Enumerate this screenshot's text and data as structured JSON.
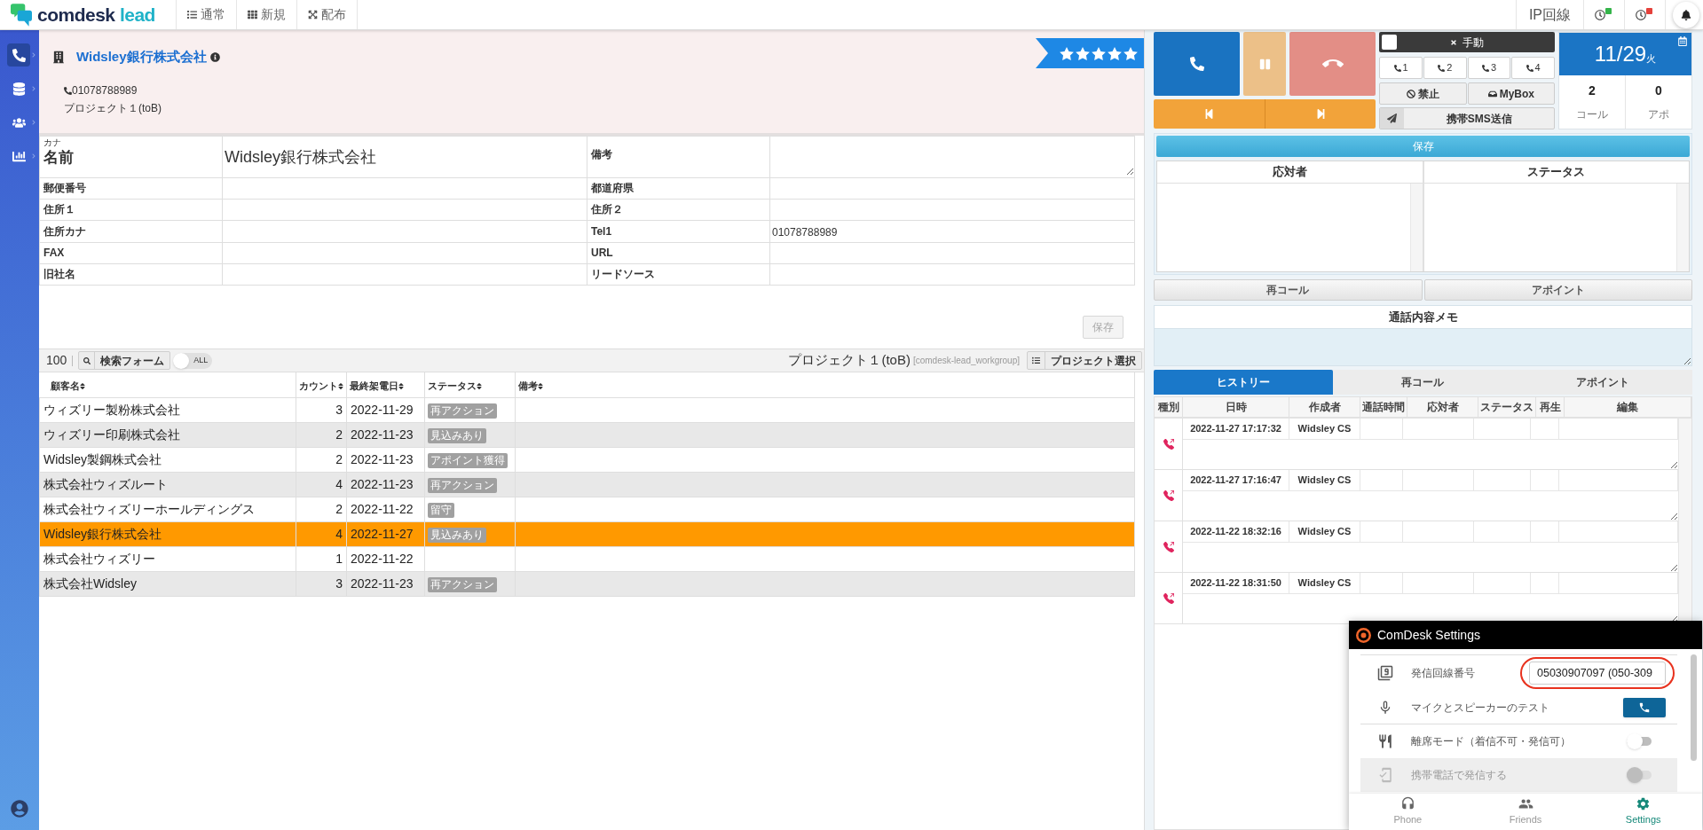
{
  "top_bar": {
    "logo": {
      "primary": "comdesk",
      "secondary": "lead"
    },
    "nav": [
      {
        "label": "通常"
      },
      {
        "label": "新規"
      },
      {
        "label": "配布"
      }
    ],
    "line_type": "IP回線",
    "indicators": [
      {
        "color": "#35b44a"
      },
      {
        "color": "#e5413b"
      }
    ]
  },
  "sidebar": {
    "items": [
      {
        "kind": "phone",
        "selected": true
      },
      {
        "kind": "database",
        "selected": false
      },
      {
        "kind": "users",
        "selected": false
      },
      {
        "kind": "chart",
        "selected": false
      }
    ]
  },
  "header": {
    "company": "Widsley銀行株式会社",
    "phone": "01078788989",
    "project": "プロジェクト１(toB)",
    "stars": 5
  },
  "form": {
    "rows": [
      {
        "cells": [
          {
            "kind": "text",
            "kana": "カナ",
            "label": "名前",
            "value": "Widsley銀行株式会社"
          },
          {
            "kind": "textarea",
            "label": "備考"
          }
        ]
      },
      {
        "cells": [
          {
            "kind": "text",
            "label": "郵便番号"
          },
          {
            "kind": "text",
            "label": "都道府県"
          }
        ]
      },
      {
        "cells": [
          {
            "kind": "text",
            "label": "住所１"
          },
          {
            "kind": "text",
            "label": "住所２"
          }
        ]
      },
      {
        "cells": [
          {
            "kind": "text",
            "label": "住所カナ"
          },
          {
            "kind": "text",
            "label": "Tel1",
            "value": "01078788989"
          }
        ]
      },
      {
        "cells": [
          {
            "kind": "text",
            "label": "FAX"
          },
          {
            "kind": "text",
            "label": "URL"
          }
        ]
      },
      {
        "cells": [
          {
            "kind": "text",
            "label": "旧社名"
          },
          {
            "kind": "text",
            "label": "リードソース"
          }
        ]
      }
    ],
    "save_button": {
      "label": "保存",
      "disabled": true
    }
  },
  "toolbar": {
    "count": "100",
    "search_button": "検索フォーム",
    "toggle": {
      "label": "ALL",
      "on": false
    },
    "project": "プロジェクト１(toB)",
    "workgroup": "[comdesk-lead_workgroup]",
    "select_button": "プロジェクト選択"
  },
  "leads": {
    "columns": [
      "顧客名",
      "カウント",
      "最終架電日",
      "ステータス",
      "備考"
    ],
    "rows": [
      {
        "name": "ウィズリー製粉株式会社",
        "count": "3",
        "date": "2022-11-29",
        "status": "再アクション",
        "selected": false
      },
      {
        "name": "ウィズリー印刷株式会社",
        "count": "2",
        "date": "2022-11-23",
        "status": "見込みあり",
        "selected": false
      },
      {
        "name": "Widsley製鋼株式会社",
        "count": "2",
        "date": "2022-11-23",
        "status": "アポイント獲得",
        "selected": false
      },
      {
        "name": "株式会社ウィズルート",
        "count": "4",
        "date": "2022-11-23",
        "status": "再アクション",
        "selected": false
      },
      {
        "name": "株式会社ウィズリーホールディングス",
        "count": "2",
        "date": "2022-11-22",
        "status": "留守",
        "selected": false
      },
      {
        "name": "Widsley銀行株式会社",
        "count": "4",
        "date": "2022-11-27",
        "status": "見込みあり",
        "selected": true
      },
      {
        "name": "株式会社ウィズリー",
        "count": "1",
        "date": "2022-11-22",
        "selected": false
      },
      {
        "name": "株式会社Widsley",
        "count": "3",
        "date": "2022-11-23",
        "status": "再アクション",
        "selected": false
      }
    ]
  },
  "call_panel": {
    "mode": {
      "label": "手動",
      "checked": false
    },
    "lines": [
      "1",
      "2",
      "3",
      "4"
    ],
    "actions": [
      {
        "kind": "ban",
        "label": "禁止"
      },
      {
        "kind": "mybox",
        "label": "MyBox"
      }
    ],
    "sms_button": "携帯SMS送信",
    "date": {
      "day": "11/29",
      "weekday": "火"
    },
    "stats": [
      {
        "value": "2",
        "label": "コール"
      },
      {
        "value": "0",
        "label": "アポ"
      }
    ]
  },
  "result_form": {
    "save_button": "保存",
    "columns": [
      "応対者",
      "ステータス"
    ],
    "buttons": [
      "再コール",
      "アポイント"
    ],
    "memo_title": "通話内容メモ"
  },
  "history": {
    "tabs": [
      {
        "label": "ヒストリー",
        "selected": true
      },
      {
        "label": "再コール",
        "selected": false
      },
      {
        "label": "アポイント",
        "selected": false
      }
    ],
    "columns": [
      "種別",
      "日時",
      "作成者",
      "通話時間",
      "応対者",
      "ステータス",
      "再生",
      "編集"
    ],
    "rows": [
      {
        "datetime": "2022-11-27 17:17:32",
        "author": "Widsley CS"
      },
      {
        "datetime": "2022-11-27 17:16:47",
        "author": "Widsley CS"
      },
      {
        "datetime": "2022-11-22 18:32:16",
        "author": "Widsley CS"
      },
      {
        "datetime": "2022-11-22 18:31:50",
        "author": "Widsley CS"
      }
    ]
  },
  "settings_popup": {
    "title": "ComDesk Settings",
    "rows": [
      {
        "kind": "field",
        "label": "発信回線番号",
        "value": "05030907097 (050-309",
        "highlighted": true,
        "disabled": false
      },
      {
        "kind": "button",
        "label": "マイクとスピーカーのテスト",
        "disabled": false
      },
      {
        "kind": "toggle",
        "label": "離席モード（着信不可・発信可）",
        "on": false,
        "disabled": false
      },
      {
        "kind": "toggle",
        "label": "携帯電話で発信する",
        "on": false,
        "disabled": true
      }
    ],
    "nav": [
      {
        "label": "Phone",
        "selected": false
      },
      {
        "label": "Friends",
        "selected": false
      },
      {
        "label": "Settings",
        "selected": true
      }
    ]
  }
}
